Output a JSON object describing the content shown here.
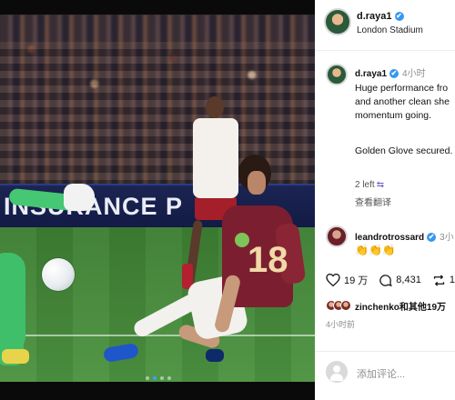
{
  "photo": {
    "adboard_text": "INSURANCE P",
    "shirt_number": "18",
    "carousel": {
      "count": 4,
      "active_index": 2
    }
  },
  "header": {
    "username": "d.raya1",
    "location": "London Stadium",
    "verified_icon": "✔"
  },
  "comments": [
    {
      "username": "d.raya1",
      "time": "4小时",
      "text_line1": "Huge performance fro",
      "text_line2": "and another clean she",
      "text_line3": "momentum going.",
      "text_line4": "Golden Glove secured.",
      "likes": "2 left",
      "translate": "查看翻译"
    },
    {
      "username": "leandrotrossard",
      "time": "3小",
      "text": "👏👏👏"
    }
  ],
  "actions": {
    "likes": "19 万",
    "comments": "8,431",
    "shares": "1"
  },
  "liked_by": "zinchenko和其他19万",
  "post_time": "4小时前",
  "add_comment_placeholder": "添加评论...",
  "colors": {
    "verified": "#3897f0",
    "claret": "#7b1f30",
    "pitch": "#4d9341"
  }
}
